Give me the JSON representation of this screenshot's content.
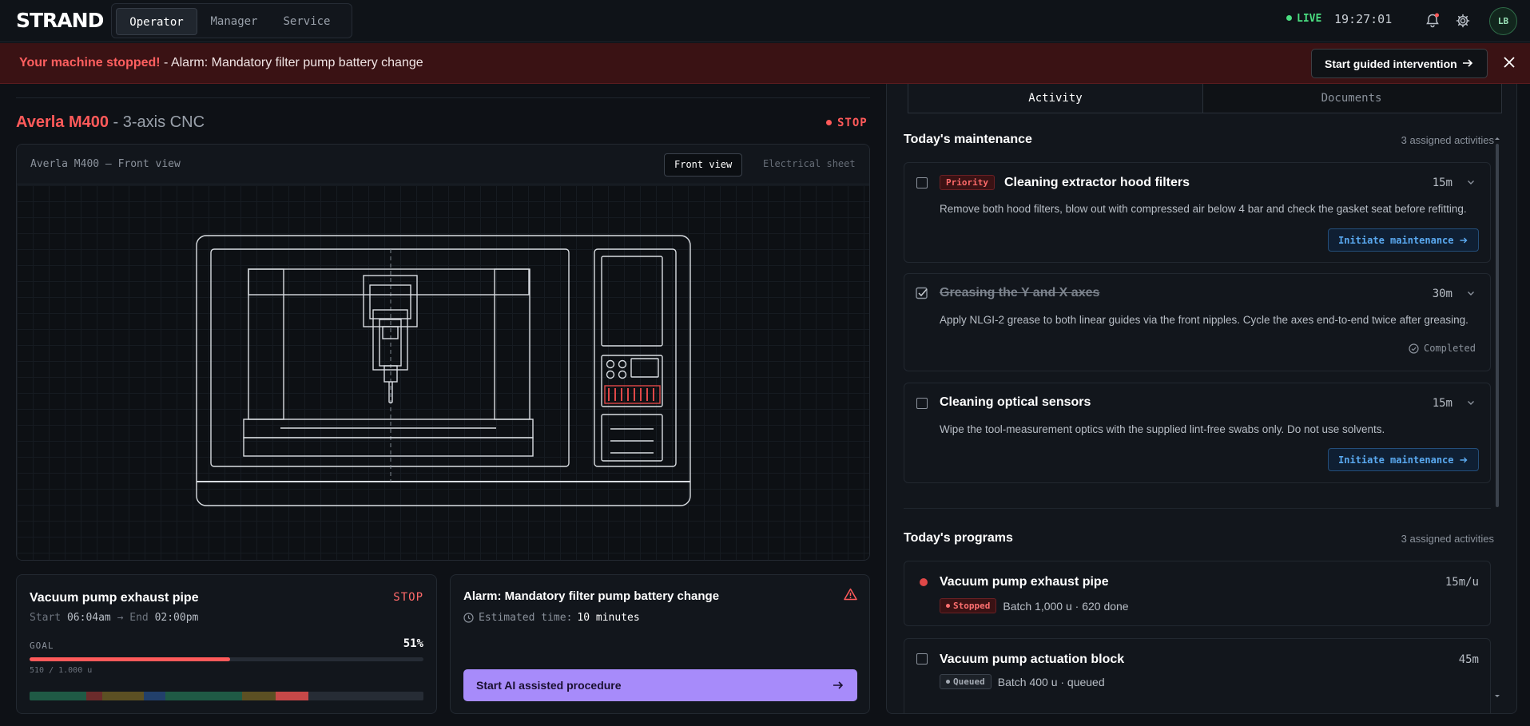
{
  "app": {
    "logo": "STRAND",
    "nav": [
      {
        "label": "Operator",
        "active": true
      },
      {
        "label": "Manager",
        "active": false
      },
      {
        "label": "Service",
        "active": false
      }
    ],
    "live_label": "LIVE",
    "clock": "19:27:01",
    "avatar_initials": "LB",
    "icons": {
      "notifications": "bell-icon",
      "settings": "gear-icon"
    }
  },
  "alarm_banner": {
    "headline": "Your machine stopped!",
    "message": " - Alarm: Mandatory filter pump battery change",
    "action_label": "Start guided intervention",
    "close_icon": "close-icon"
  },
  "machine": {
    "name": "Averla M400",
    "subtitle": " - 3-axis CNC",
    "status": "STOP",
    "status_color": "#ff5a5a",
    "viewer": {
      "caption": "Averla M400 — Front view",
      "views": [
        {
          "label": "Front view",
          "active": true
        },
        {
          "label": "Electrical sheet",
          "active": false
        }
      ]
    }
  },
  "job": {
    "title": "Vacuum pump exhaust pipe",
    "status": "STOP",
    "start_label": "Start",
    "start_time": "06:04am",
    "end_label": "End",
    "end_time": "02:00pm",
    "goal_label": "GOAL",
    "progress_pct": 51,
    "progress_text": "51%",
    "count_text": "510 / 1.000 u",
    "timeline": [
      {
        "share": 14.5,
        "color": "#1f5a45"
      },
      {
        "share": 4,
        "color": "#6b2b2b"
      },
      {
        "share": 10.5,
        "color": "#5c5023"
      },
      {
        "share": 5.5,
        "color": "#22406b"
      },
      {
        "share": 19.5,
        "color": "#1f5a45"
      },
      {
        "share": 8.5,
        "color": "#5c5023"
      },
      {
        "share": 8.2,
        "color": "#c74848"
      },
      {
        "share": 29.3,
        "color": "#262c35"
      }
    ]
  },
  "alarm_card": {
    "title": "Alarm: Mandatory filter pump battery change",
    "estimate_label": "Estimated time:",
    "estimate_value": "10 minutes",
    "action_label": "Start AI assisted procedure",
    "accent": "#a78bfa"
  },
  "panel": {
    "tabs": [
      {
        "label": "Activity",
        "active": true
      },
      {
        "label": "Documents",
        "active": false
      }
    ],
    "maintenance": {
      "title": "Today's maintenance",
      "count": "3 assigned activities",
      "items": [
        {
          "priority_label": "Priority",
          "title": "Cleaning extractor hood filters",
          "duration": "15m",
          "description": "Remove both hood filters, blow out with compressed air below 4 bar and check the gasket seat before refitting.",
          "action_label": "Initiate maintenance",
          "done": false
        },
        {
          "priority_label": "",
          "title": "Greasing the Y and X axes",
          "duration": "30m",
          "description": "Apply NLGI-2 grease to both linear guides via the front nipples. Cycle the axes end-to-end twice after greasing.",
          "completed_label": "Completed",
          "done": true
        },
        {
          "priority_label": "",
          "title": "Cleaning optical sensors",
          "duration": "15m",
          "description": "Wipe the tool-measurement optics with the supplied lint-free swabs only. Do not use solvents.",
          "action_label": "Initiate maintenance",
          "done": false
        }
      ]
    },
    "programs": {
      "title": "Today's programs",
      "count": "3 assigned activities",
      "items": [
        {
          "title": "Vacuum pump exhaust pipe",
          "rate": "15m/u",
          "badge": "Stopped",
          "meta": "Batch 1,000 u · 620 done"
        },
        {
          "title": "Vacuum pump actuation block",
          "rate": "45m",
          "badge": "Queued",
          "meta": "Batch 400 u · queued"
        }
      ]
    }
  }
}
